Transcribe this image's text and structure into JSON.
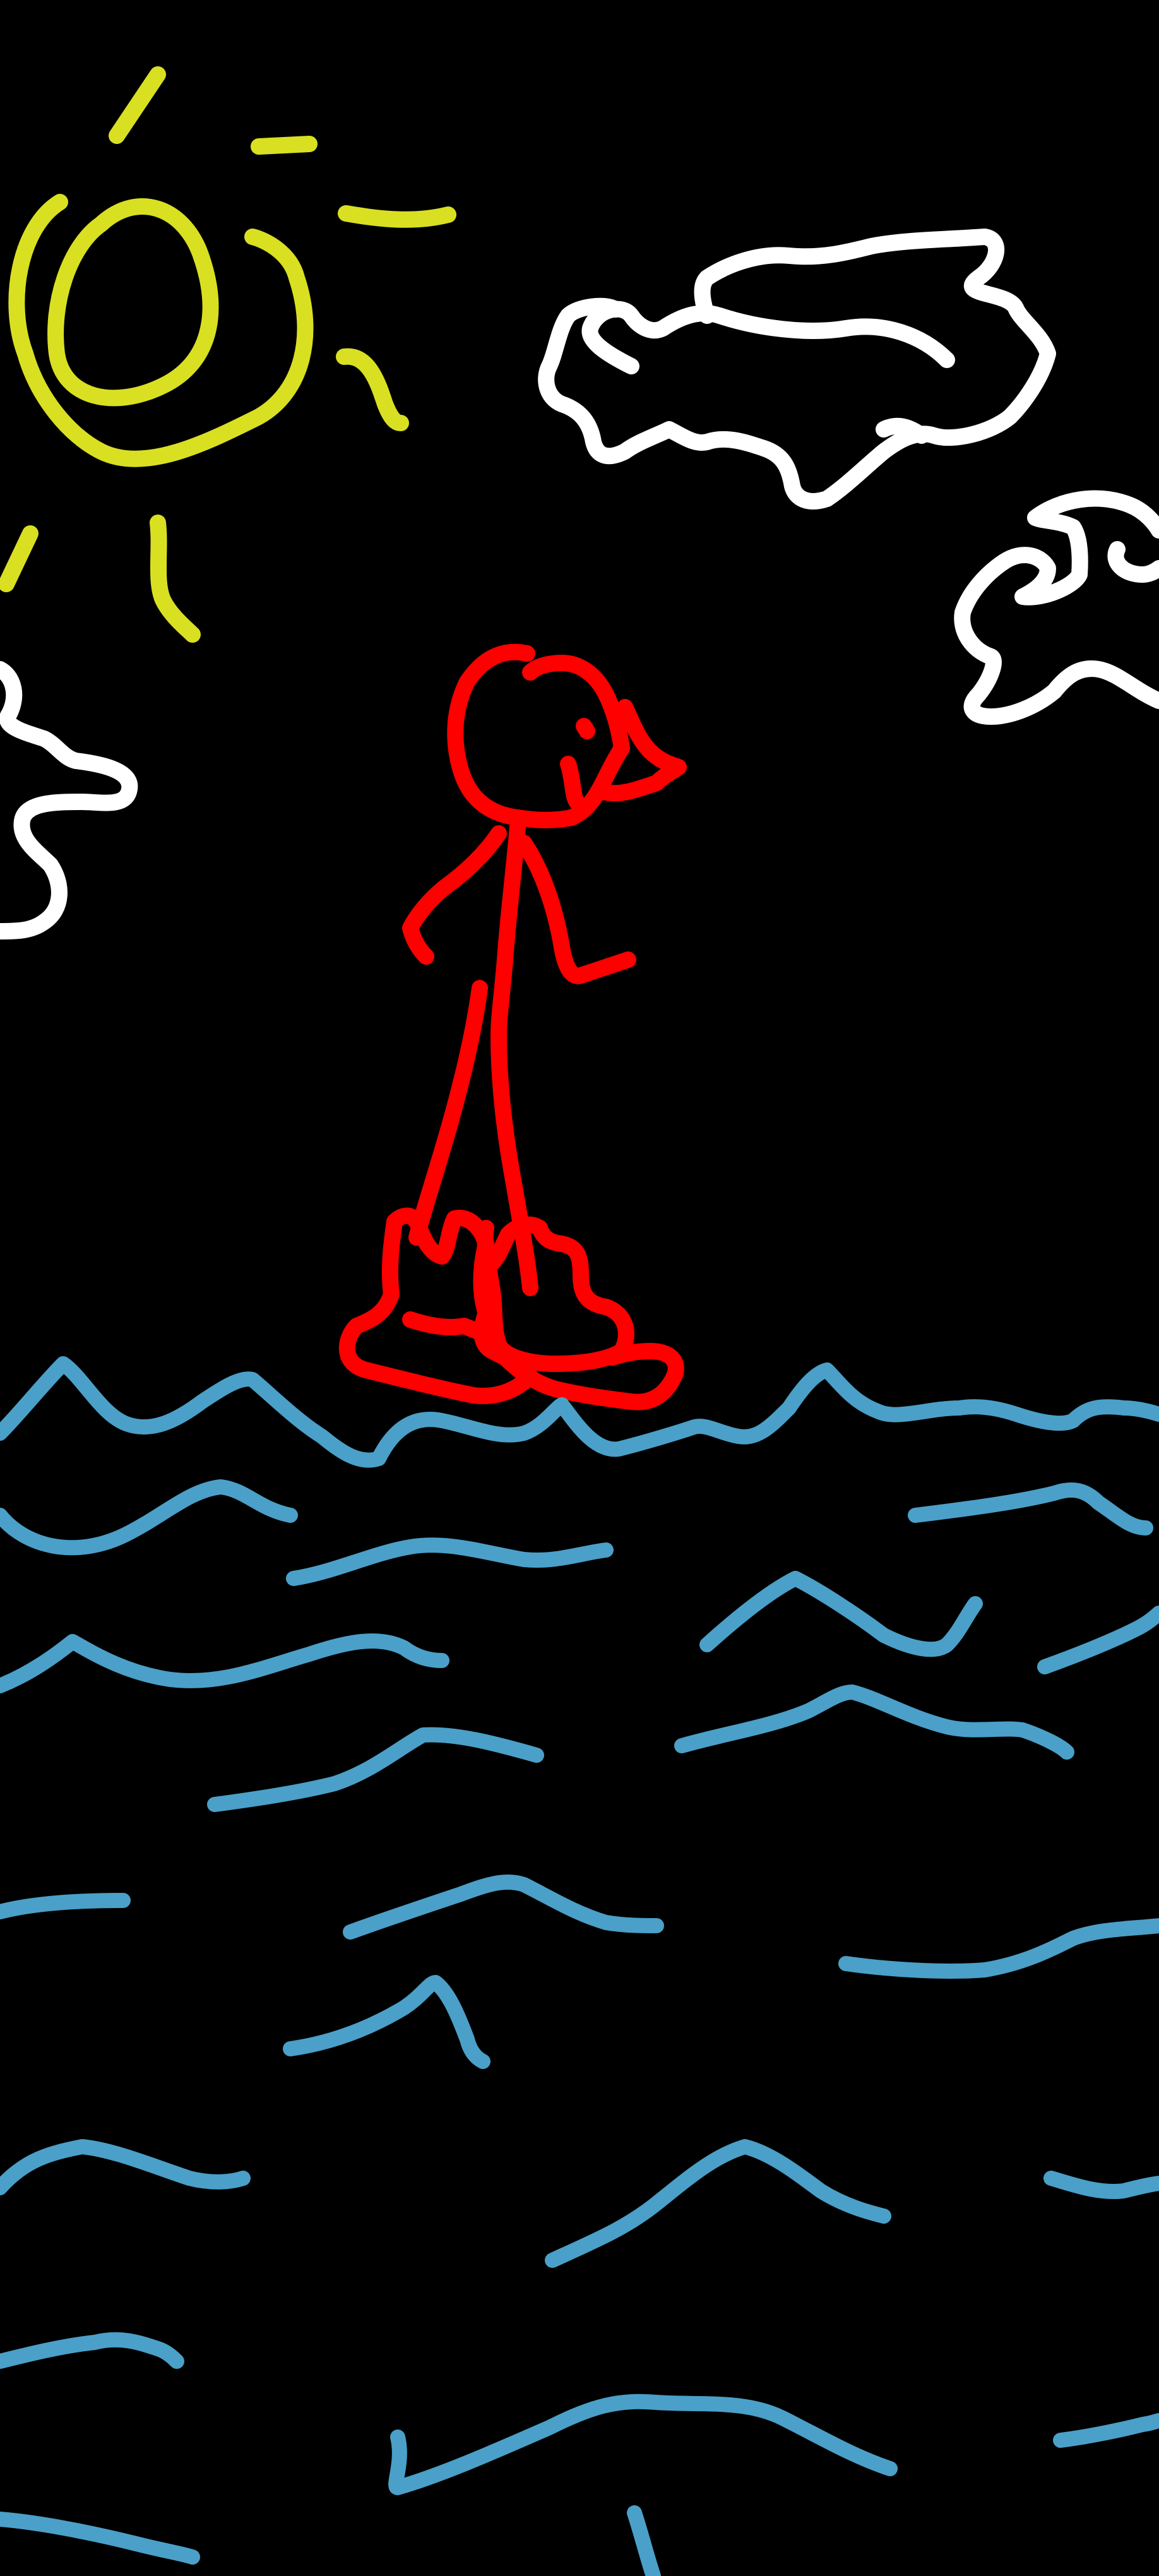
{
  "artwork": {
    "background_color": "#000000",
    "colors": {
      "sun": "#D9E021",
      "cloud": "#FFFFFF",
      "figure": "#FF0000",
      "water": "#4AA0C8"
    },
    "subjects": [
      "sun",
      "cloud",
      "stick-figure",
      "waves"
    ]
  }
}
